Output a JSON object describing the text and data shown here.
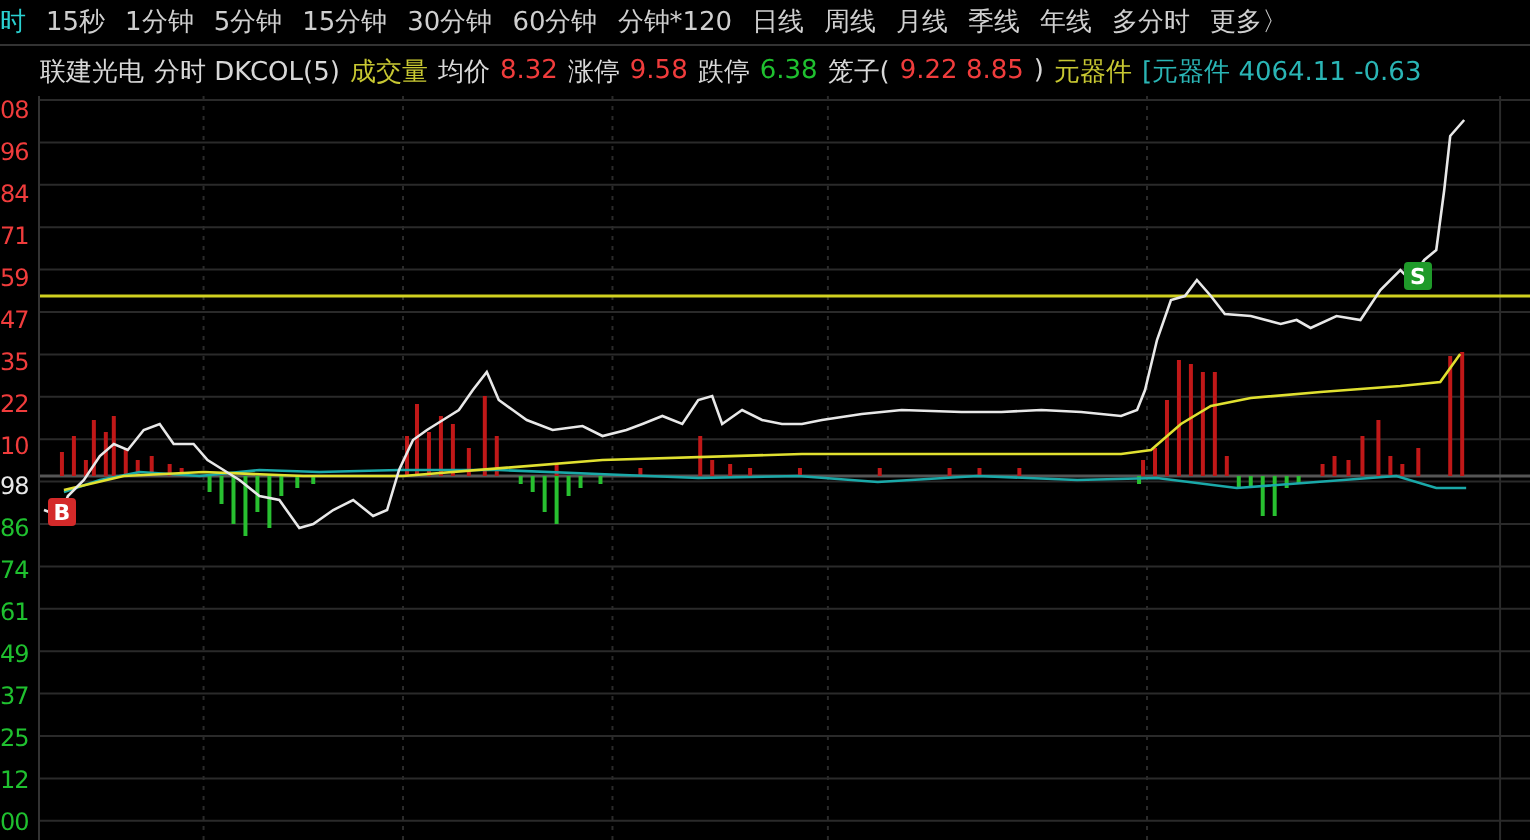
{
  "period_tabs": [
    {
      "label": "时",
      "selected": true
    },
    {
      "label": "15秒",
      "selected": false
    },
    {
      "label": "1分钟",
      "selected": false
    },
    {
      "label": "5分钟",
      "selected": false
    },
    {
      "label": "15分钟",
      "selected": false
    },
    {
      "label": "30分钟",
      "selected": false
    },
    {
      "label": "60分钟",
      "selected": false
    },
    {
      "label": "分钟*120",
      "selected": false
    },
    {
      "label": "日线",
      "selected": false
    },
    {
      "label": "周线",
      "selected": false
    },
    {
      "label": "月线",
      "selected": false
    },
    {
      "label": "季线",
      "selected": false
    },
    {
      "label": "年线",
      "selected": false
    },
    {
      "label": "多分时",
      "selected": false
    },
    {
      "label": "更多〉",
      "selected": false
    }
  ],
  "info_line": [
    {
      "text": "联建光电",
      "kind": "plain"
    },
    {
      "text": "分时 DKCOL(5)",
      "kind": "plain"
    },
    {
      "text": "成交量",
      "kind": "yellow"
    },
    {
      "text": "均价",
      "kind": "plain"
    },
    {
      "text": "8.32",
      "kind": "up"
    },
    {
      "text": "涨停",
      "kind": "plain"
    },
    {
      "text": "9.58",
      "kind": "up"
    },
    {
      "text": "跌停",
      "kind": "plain"
    },
    {
      "text": "6.38",
      "kind": "down"
    },
    {
      "text": "笼子(",
      "kind": "plain"
    },
    {
      "text": "9.22 8.85",
      "kind": "up"
    },
    {
      "text": ")",
      "kind": "plain"
    },
    {
      "text": "元器件",
      "kind": "yellow"
    },
    {
      "text": "[元器件 4064.11 -0.63",
      "kind": "index"
    }
  ],
  "y_axis_labels": [
    {
      "text": "08",
      "kind": "up"
    },
    {
      "text": "96",
      "kind": "up"
    },
    {
      "text": "84",
      "kind": "up"
    },
    {
      "text": "71",
      "kind": "up"
    },
    {
      "text": "59",
      "kind": "up"
    },
    {
      "text": "47",
      "kind": "up"
    },
    {
      "text": "35",
      "kind": "up"
    },
    {
      "text": "22",
      "kind": "up"
    },
    {
      "text": "10",
      "kind": "up"
    },
    {
      "text": "98",
      "kind": "flat"
    },
    {
      "text": "86",
      "kind": "down"
    },
    {
      "text": "74",
      "kind": "down"
    },
    {
      "text": "61",
      "kind": "down"
    },
    {
      "text": "49",
      "kind": "down"
    },
    {
      "text": "37",
      "kind": "down"
    },
    {
      "text": "25",
      "kind": "down"
    },
    {
      "text": "12",
      "kind": "down"
    },
    {
      "text": "00",
      "kind": "down"
    }
  ],
  "signals": [
    {
      "text": "B",
      "kind": "buy"
    },
    {
      "text": "S",
      "kind": "sell"
    }
  ]
}
